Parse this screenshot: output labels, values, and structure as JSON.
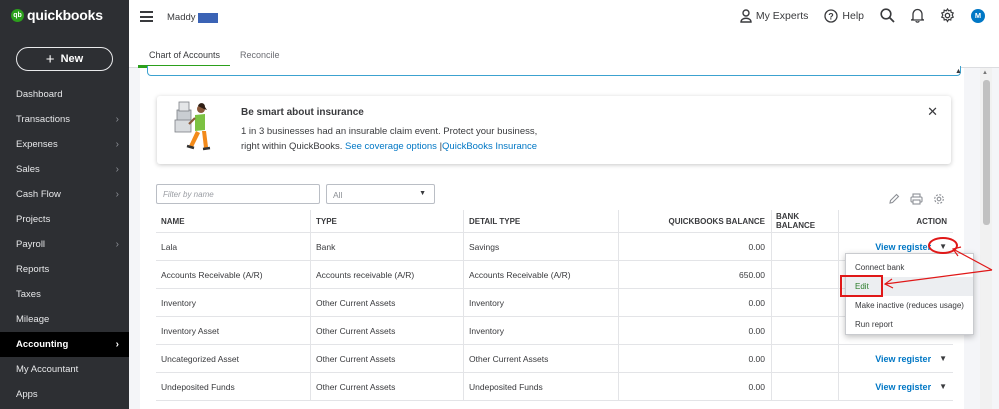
{
  "brand": {
    "logo_badge": "qb",
    "logo_text": "quickbooks"
  },
  "sidebar": {
    "new_label": "New",
    "items": [
      {
        "label": "Dashboard",
        "chevron": false
      },
      {
        "label": "Transactions",
        "chevron": true
      },
      {
        "label": "Expenses",
        "chevron": true
      },
      {
        "label": "Sales",
        "chevron": true
      },
      {
        "label": "Cash Flow",
        "chevron": true
      },
      {
        "label": "Projects",
        "chevron": false
      },
      {
        "label": "Payroll",
        "chevron": true
      },
      {
        "label": "Reports",
        "chevron": false
      },
      {
        "label": "Taxes",
        "chevron": false
      },
      {
        "label": "Mileage",
        "chevron": false
      },
      {
        "label": "Accounting",
        "chevron": true,
        "active": true
      },
      {
        "label": "My Accountant",
        "chevron": false
      },
      {
        "label": "Apps",
        "chevron": false
      }
    ]
  },
  "header": {
    "company": "Maddy",
    "my_experts": "My Experts",
    "help": "Help",
    "avatar": "M"
  },
  "tabs": [
    {
      "label": "Chart of Accounts",
      "active": true
    },
    {
      "label": "Reconcile",
      "active": false
    }
  ],
  "banner": {
    "title": "Be smart about insurance",
    "line1": "1 in 3 businesses had an insurable claim event. Protect your business,",
    "line2_prefix": "right within QuickBooks.",
    "link1": "See coverage options",
    "separator": "|",
    "link2": "QuickBooks Insurance",
    "close": "✕"
  },
  "filter": {
    "placeholder": "Filter by name",
    "select_value": "All"
  },
  "table": {
    "headers": [
      "NAME",
      "TYPE",
      "DETAIL TYPE",
      "QUICKBOOKS BALANCE",
      "BANK BALANCE",
      "ACTION"
    ],
    "rows": [
      {
        "name": "Lala",
        "type": "Bank",
        "detail": "Savings",
        "qb": "0.00",
        "bank": "",
        "action": "View register"
      },
      {
        "name": "Accounts Receivable (A/R)",
        "type": "Accounts receivable (A/R)",
        "detail": "Accounts Receivable (A/R)",
        "qb": "650.00",
        "bank": "",
        "action": ""
      },
      {
        "name": "Inventory",
        "type": "Other Current Assets",
        "detail": "Inventory",
        "qb": "0.00",
        "bank": "",
        "action": ""
      },
      {
        "name": "Inventory Asset",
        "type": "Other Current Assets",
        "detail": "Inventory",
        "qb": "0.00",
        "bank": "",
        "action": ""
      },
      {
        "name": "Uncategorized Asset",
        "type": "Other Current Assets",
        "detail": "Other Current Assets",
        "qb": "0.00",
        "bank": "",
        "action": "View register"
      },
      {
        "name": "Undeposited Funds",
        "type": "Other Current Assets",
        "detail": "Undeposited Funds",
        "qb": "0.00",
        "bank": "",
        "action": "View register"
      }
    ]
  },
  "dropdown": {
    "items": [
      "Connect bank",
      "Edit",
      "Make inactive (reduces usage)",
      "Run report"
    ],
    "highlighted": "Edit"
  },
  "colors": {
    "accent_green": "#2ca01c",
    "link_blue": "#0077c5",
    "sidebar_bg": "#2d2f33",
    "annotation_red": "#e01818"
  }
}
